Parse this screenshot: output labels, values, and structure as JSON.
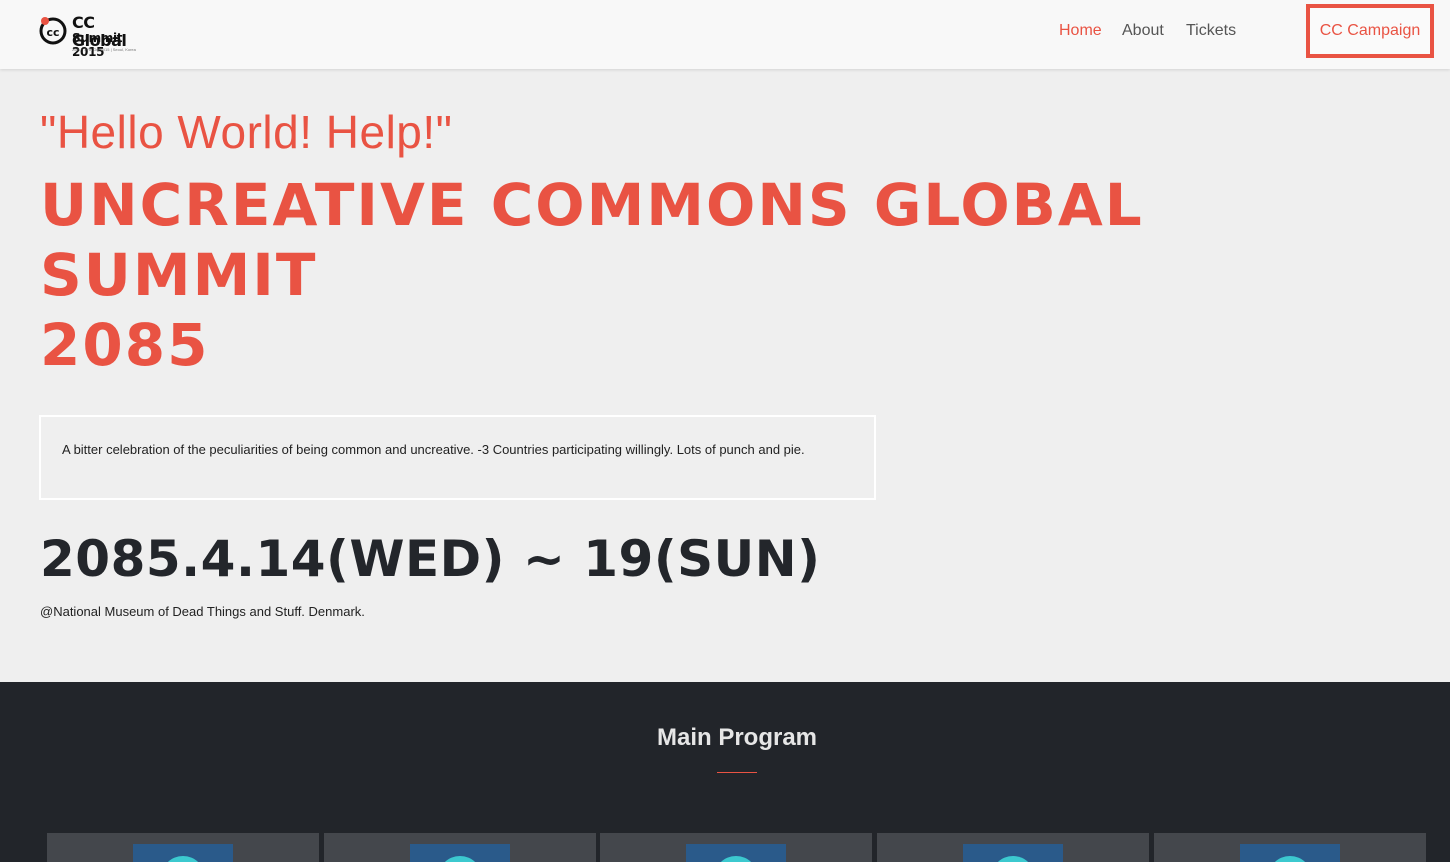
{
  "header": {
    "logo": {
      "line1": "CC Global",
      "line2": "Summit 2015",
      "line3": "26th ~ 27th Oct 2015  |  Seoul, Korea"
    },
    "nav": [
      {
        "label": "Home",
        "active": true
      },
      {
        "label": "About",
        "active": false
      },
      {
        "label": "Tickets",
        "active": false
      }
    ],
    "cta_label": "CC Campaign"
  },
  "hero": {
    "tagline": "\"Hello World! Help!\"",
    "headline_lines": [
      "UNCREATIVE COMMONS GLOBAL",
      "SUMMIT",
      "2085"
    ],
    "description": "A bitter celebration of the peculiarities of being common and uncreative. -3 Countries participating willingly. Lots of punch and pie.",
    "date": "2085.4.14(WED) ~ 19(SUN)",
    "venue": "@National Museum of Dead Things and Stuff. Denmark."
  },
  "program": {
    "title": "Main Program",
    "card_count_visible": 5
  },
  "colors": {
    "accent": "#e95343",
    "dark_section": "#22252a",
    "page_bg": "#efefef",
    "card_bg": "#44474c",
    "thumb_blue": "#2a5a8a",
    "thumb_circle": "#3cc9cf"
  }
}
